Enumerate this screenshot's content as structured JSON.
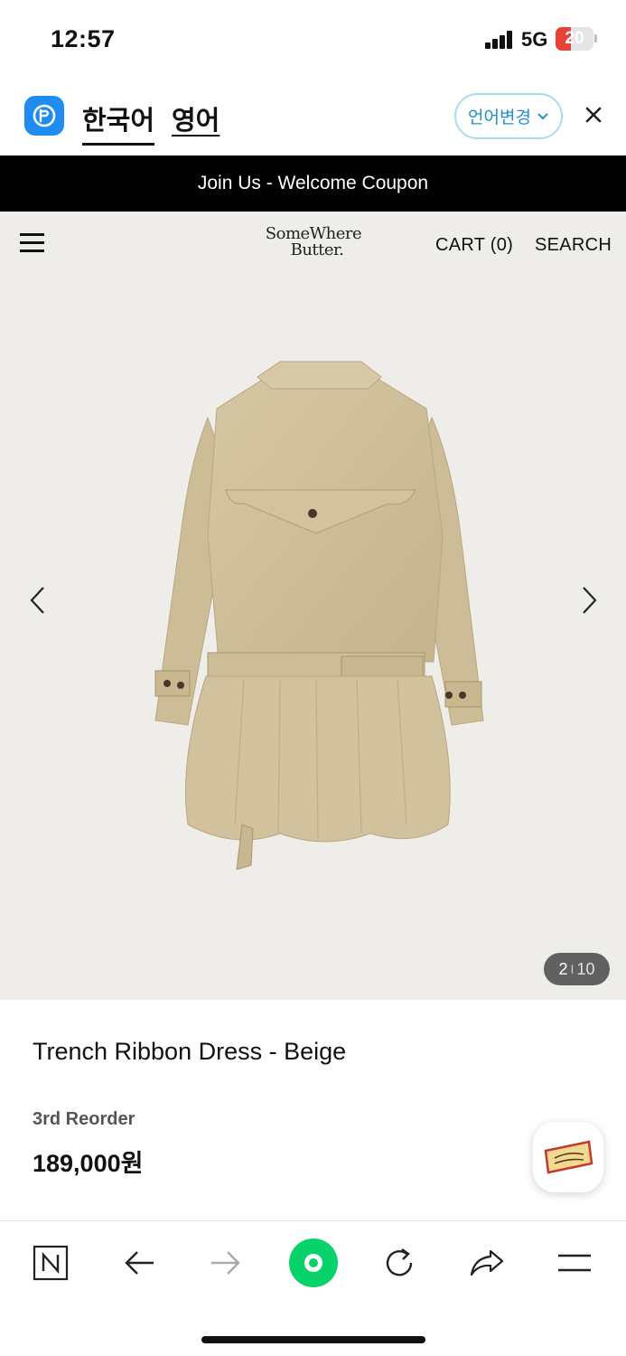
{
  "status_bar": {
    "time": "12:57",
    "network": "5G",
    "battery_level": "20",
    "battery_color": "#e5423a"
  },
  "translator": {
    "logo_icon": "papago-icon",
    "lang_source": "한국어",
    "lang_target": "영어",
    "change_label": "언어변경",
    "close_icon": "close-icon",
    "accent_color": "#1f8fce"
  },
  "promo": {
    "text": "Join Us - Welcome Coupon"
  },
  "site_header": {
    "menu_icon": "hamburger-icon",
    "brand_line1": "SomeWhere",
    "brand_line2": "Butter.",
    "cart_label": "CART",
    "cart_count": "(0)",
    "search_label": "SEARCH"
  },
  "gallery": {
    "current": "2",
    "separator": "I",
    "total": "10",
    "prev_icon": "chevron-left-icon",
    "next_icon": "chevron-right-icon"
  },
  "product": {
    "name": "Trench Ribbon Dress - Beige",
    "badge": "3rd Reorder",
    "price": "189,000원"
  },
  "browser_toolbar": {
    "items": [
      "naver-home-icon",
      "back-icon",
      "forward-icon",
      "green-dot-icon",
      "reload-icon",
      "share-icon",
      "menu-icon"
    ]
  }
}
